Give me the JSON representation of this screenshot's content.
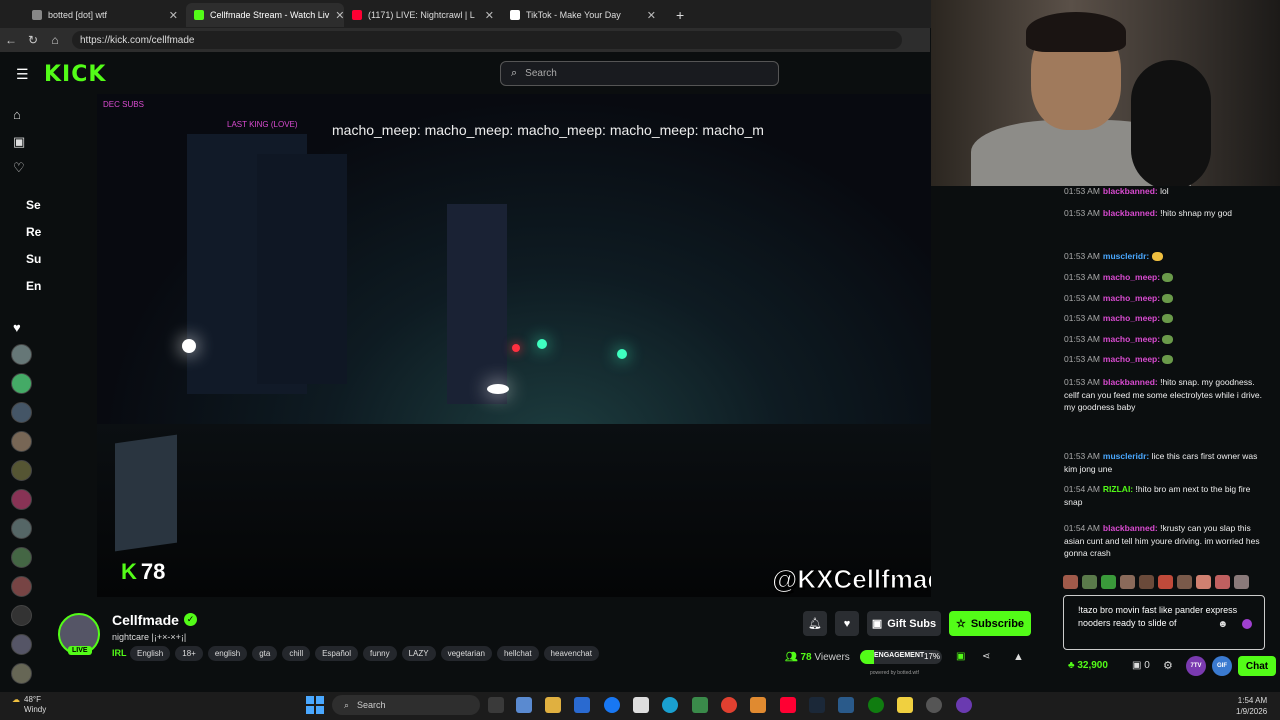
{
  "browser": {
    "tabs": [
      {
        "title": "botted [dot] wtf",
        "color": "#888888"
      },
      {
        "title": "Cellfmade Stream - Watch Liv",
        "color": "#53fc18"
      },
      {
        "title": "(1171) LIVE: Nightcrawl | L",
        "color": "#ff0033"
      },
      {
        "title": "TikTok - Make Your Day",
        "color": "#ffffff"
      }
    ],
    "url": "https://kick.com/cellfmade"
  },
  "kick": {
    "logo": "KICK",
    "search_placeholder": "Search"
  },
  "sidebar": {
    "sections": [
      "Se",
      "Re",
      "Su",
      "En"
    ]
  },
  "video": {
    "chat_overlay": "macho_meep: macho_meep: macho_meep: macho_meep: macho_m",
    "viewer_overlay": "78",
    "watermark": "@KXCellfmade",
    "overlay_top1": "DEC SUBS",
    "overlay_top2": "LAST KING (LOVE)"
  },
  "stream": {
    "streamer": "Cellfmade",
    "title": "nightcare |¡+×-×+¡|",
    "live_badge": "LIVE",
    "category": "IRL",
    "tags": [
      "English",
      "18+",
      "english",
      "gta",
      "chill",
      "Español",
      "funny",
      "LAZY",
      "vegetarian",
      "hellchat",
      "heavenchat"
    ],
    "gift_label": "Gift Subs",
    "subscribe_label": "Subscribe",
    "viewers": "78",
    "viewers_label": "Viewers",
    "engagement_label": "ENGAGEMENT",
    "engagement_pct": "17%",
    "engagement_value": 0.17,
    "powered_by": "powered by botted.wtf"
  },
  "chat": {
    "messages": [
      {
        "time": "01:53 AM",
        "user": "blackbanned:",
        "color": "#d94bd0",
        "text": "lol"
      },
      {
        "time": "01:53 AM",
        "user": "blackbanned:",
        "color": "#d94bd0",
        "text": "!hito shnap my god"
      },
      {
        "time": "01:53 AM",
        "user": "muscleridr:",
        "color": "#4aa8ff",
        "text": ""
      },
      {
        "time": "01:53 AM",
        "user": "macho_meep:",
        "color": "#d94bd0",
        "text": ""
      },
      {
        "time": "01:53 AM",
        "user": "macho_meep:",
        "color": "#d94bd0",
        "text": ""
      },
      {
        "time": "01:53 AM",
        "user": "macho_meep:",
        "color": "#d94bd0",
        "text": ""
      },
      {
        "time": "01:53 AM",
        "user": "macho_meep:",
        "color": "#d94bd0",
        "text": ""
      },
      {
        "time": "01:53 AM",
        "user": "macho_meep:",
        "color": "#d94bd0",
        "text": ""
      },
      {
        "time": "01:53 AM",
        "user": "blackbanned:",
        "color": "#d94bd0",
        "text": "!hito snap. my goodness. cellf can you feed me some electrolytes while i drive. my goodness baby"
      },
      {
        "time": "01:53 AM",
        "user": "muscleridr:",
        "color": "#4aa8ff",
        "text": "lice this cars first owner was kim jong une"
      },
      {
        "time": "01:54 AM",
        "user": "RIZLAI:",
        "color": "#53fc18",
        "text": "!hito bro am next to the big fire snap"
      },
      {
        "time": "01:54 AM",
        "user": "blackbanned:",
        "color": "#d94bd0",
        "text": "!krusty can you slap this asian cunt and tell him youre driving. im worried hes gonna crash"
      }
    ],
    "input_text": "!tazo bro movin fast like pander express nooders ready to slide of",
    "points": "32,900",
    "count": "0",
    "chat_button": "Chat",
    "badges": [
      "7TV",
      "GIF",
      ""
    ]
  },
  "taskbar": {
    "temp": "48°F",
    "condition": "Windy",
    "search": "Search",
    "time": "1:54 AM",
    "date": "1/9/2026"
  }
}
